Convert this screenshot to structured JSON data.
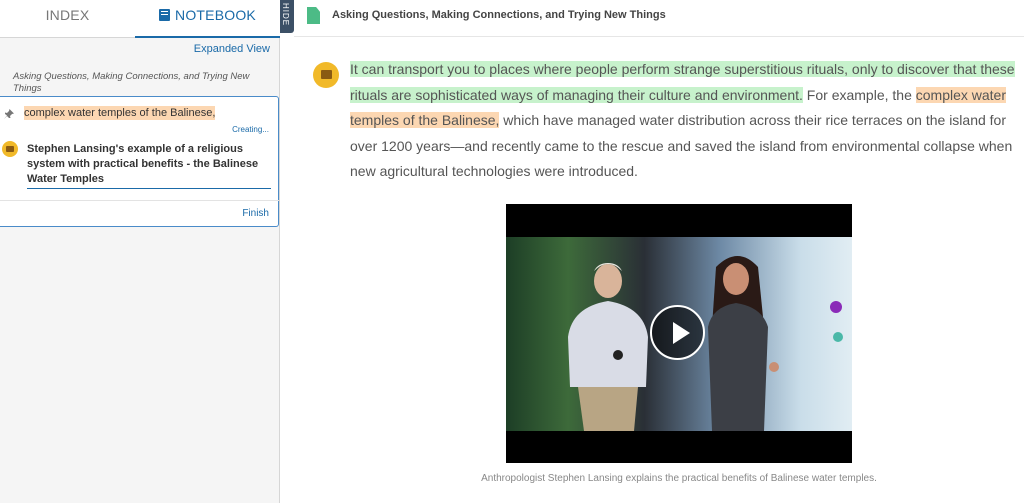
{
  "tabs": {
    "index": "INDEX",
    "notebook": "NOTEBOOK"
  },
  "notebook": {
    "expanded_view": "Expanded View",
    "section_title": "Asking Questions, Making Connections, and Trying New Things",
    "highlight_text": "complex water temples of the Balinese,",
    "status": "Creating...",
    "note_text": "Stephen Lansing's example of a religious system with practical benefits - the Balinese Water Temples",
    "finish": "Finish"
  },
  "hide_tab": "HIDE",
  "header": {
    "title": "Asking Questions, Making Connections, and Trying New Things"
  },
  "article": {
    "highlight_green": "It can transport you to places where people perform strange superstitious rituals, only to discover that these rituals are sophisticated ways of managing their culture and environment.",
    "text_1": " For example, the ",
    "highlight_orange": "complex water temples of the Balinese,",
    "text_2": " which have managed water distribution across their rice terraces on the island for over 1200 years—and recently came to the rescue and saved the island from environmental collapse when new agricultural technologies were introduced."
  },
  "video": {
    "caption": "Anthropologist Stephen Lansing explains the practical benefits of Balinese water temples."
  },
  "colors": {
    "accent": "#1a6aa8",
    "highlight_green": "#c7f2cc",
    "highlight_orange": "#fcd7b2",
    "note_badge": "#f1b929",
    "doc_icon": "#4cbb86"
  },
  "icons": [
    "notebook-icon",
    "pin-icon",
    "note-icon",
    "document-icon",
    "play-icon"
  ]
}
